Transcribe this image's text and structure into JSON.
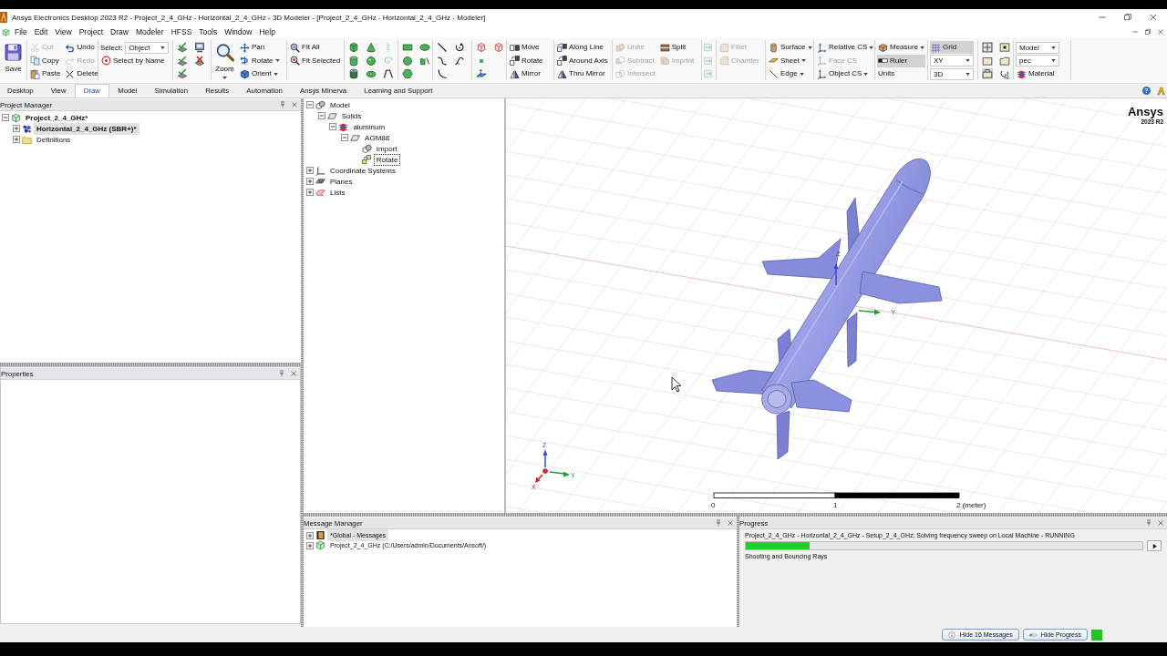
{
  "window": {
    "title": "Ansys Electronics Desktop 2023 R2 - Project_2_4_GHz - Horizontal_2_4_GHz - 3D Modeler - [Project_2_4_GHz - Horizontal_2_4_GHz - Modeler]"
  },
  "menu": [
    "File",
    "Edit",
    "View",
    "Project",
    "Draw",
    "Modeler",
    "HFSS",
    "Tools",
    "Window",
    "Help"
  ],
  "ribbon": {
    "groups": [
      {
        "columns": [
          [
            {
              "kind": "large",
              "label": "Save",
              "disabled": false,
              "on": false
            }
          ]
        ]
      },
      {
        "columns": [
          [
            {
              "kind": "button",
              "label": "Cut",
              "disabled": true,
              "on": false
            },
            {
              "kind": "button",
              "label": "Copy",
              "disabled": false,
              "on": false
            },
            {
              "kind": "button",
              "label": "Paste",
              "disabled": false,
              "on": false
            }
          ],
          [
            {
              "kind": "button",
              "label": "Undo",
              "disabled": false,
              "on": false
            },
            {
              "kind": "button",
              "label": "Redo",
              "disabled": true,
              "on": false
            },
            {
              "kind": "button",
              "label": "Delete",
              "disabled": false,
              "on": false
            }
          ]
        ]
      },
      {
        "columns": [
          [
            {
              "kind": "select",
              "label": "Select:",
              "value": "Object",
              "disabled": false,
              "on": false
            },
            {
              "kind": "button",
              "label": "Select by Name",
              "disabled": false,
              "on": false
            }
          ]
        ]
      },
      {
        "columns": [
          [
            {
              "kind": "icon",
              "disabled": false,
              "on": false
            },
            {
              "kind": "icon",
              "disabled": false,
              "on": false
            },
            {
              "kind": "icon",
              "disabled": false,
              "on": false
            }
          ],
          [
            {
              "kind": "icon",
              "disabled": false,
              "on": false
            },
            {
              "kind": "icon",
              "disabled": false,
              "on": false
            }
          ]
        ]
      },
      {
        "columns": [
          [
            {
              "kind": "large",
              "label": "Zoom",
              "menu": true,
              "disabled": false,
              "on": false
            }
          ],
          [
            {
              "kind": "button",
              "label": "Pan",
              "disabled": false,
              "on": false
            },
            {
              "kind": "button",
              "label": "Rotate",
              "menu": true,
              "disabled": false,
              "on": false
            },
            {
              "kind": "button",
              "label": "Orient",
              "menu": true,
              "disabled": false,
              "on": false
            }
          ]
        ]
      },
      {
        "columns": [
          [
            {
              "kind": "button",
              "label": "Fit All",
              "disabled": false,
              "on": false
            },
            {
              "kind": "button",
              "label": "Fit Selected",
              "disabled": false,
              "on": false
            }
          ]
        ]
      },
      {
        "columns": [
          [
            {
              "kind": "icon",
              "disabled": false,
              "on": false
            },
            {
              "kind": "icon",
              "disabled": false,
              "on": false
            },
            {
              "kind": "icon",
              "disabled": false,
              "on": false
            }
          ],
          [
            {
              "kind": "icon",
              "disabled": false,
              "on": false
            },
            {
              "kind": "icon",
              "disabled": false,
              "on": false
            },
            {
              "kind": "icon",
              "disabled": false,
              "on": false
            }
          ],
          [
            {
              "kind": "icon",
              "disabled": true,
              "on": false
            },
            {
              "kind": "icon",
              "disabled": true,
              "on": false
            },
            {
              "kind": "icon",
              "disabled": false,
              "on": false
            }
          ]
        ]
      },
      {
        "columns": [
          [
            {
              "kind": "icon",
              "disabled": false,
              "on": false
            },
            {
              "kind": "icon",
              "disabled": false,
              "on": false
            },
            {
              "kind": "icon",
              "disabled": false,
              "on": false
            }
          ],
          [
            {
              "kind": "icon",
              "disabled": false,
              "on": false
            },
            {
              "kind": "icon",
              "disabled": false,
              "on": false
            }
          ]
        ]
      },
      {
        "columns": [
          [
            {
              "kind": "icon",
              "disabled": false,
              "on": false
            },
            {
              "kind": "icon",
              "disabled": false,
              "on": false
            },
            {
              "kind": "icon",
              "disabled": false,
              "on": false
            }
          ],
          [
            {
              "kind": "icon",
              "disabled": false,
              "on": false
            },
            {
              "kind": "icon",
              "disabled": false,
              "on": false
            }
          ]
        ]
      },
      {
        "columns": [
          [
            {
              "kind": "icon",
              "disabled": false,
              "on": false
            },
            {
              "kind": "icon",
              "disabled": false,
              "on": false
            },
            {
              "kind": "icon",
              "disabled": false,
              "on": false
            }
          ],
          [
            {
              "kind": "icon",
              "disabled": false,
              "on": false
            }
          ]
        ]
      },
      {
        "columns": [
          [
            {
              "kind": "button",
              "label": "Move",
              "disabled": false,
              "on": false
            },
            {
              "kind": "button",
              "label": "Rotate",
              "disabled": false,
              "on": false
            },
            {
              "kind": "button",
              "label": "Mirror",
              "disabled": false,
              "on": false
            }
          ]
        ]
      },
      {
        "columns": [
          [
            {
              "kind": "button",
              "label": "Along Line",
              "disabled": false,
              "on": false
            },
            {
              "kind": "button",
              "label": "Around Axis",
              "disabled": false,
              "on": false
            },
            {
              "kind": "button",
              "label": "Thru Mirror",
              "disabled": false,
              "on": false
            }
          ]
        ]
      },
      {
        "columns": [
          [
            {
              "kind": "button",
              "label": "Unite",
              "disabled": true,
              "on": false
            },
            {
              "kind": "button",
              "label": "Subtract",
              "disabled": true,
              "on": false
            },
            {
              "kind": "button",
              "label": "Intersect",
              "disabled": true,
              "on": false
            }
          ],
          [
            {
              "kind": "button",
              "label": "Split",
              "disabled": false,
              "on": false
            },
            {
              "kind": "button",
              "label": "Imprint",
              "disabled": true,
              "on": false
            }
          ]
        ]
      },
      {
        "columns": [
          [
            {
              "kind": "icon",
              "disabled": true,
              "on": false
            },
            {
              "kind": "icon",
              "disabled": true,
              "on": false
            },
            {
              "kind": "icon",
              "disabled": true,
              "on": false
            }
          ]
        ]
      },
      {
        "columns": [
          [
            {
              "kind": "button",
              "label": "Fillet",
              "disabled": true,
              "on": false
            },
            {
              "kind": "button",
              "label": "Chamfer",
              "disabled": true,
              "on": false
            }
          ]
        ]
      },
      {
        "columns": [
          [
            {
              "kind": "button",
              "label": "Surface",
              "menu": true,
              "disabled": false,
              "on": false
            },
            {
              "kind": "button",
              "label": "Sheet",
              "menu": true,
              "disabled": false,
              "on": false
            },
            {
              "kind": "button",
              "label": "Edge",
              "menu": true,
              "disabled": false,
              "on": false
            }
          ]
        ]
      },
      {
        "columns": [
          [
            {
              "kind": "button",
              "label": "Relative CS",
              "menu": true,
              "disabled": false,
              "on": false
            },
            {
              "kind": "button",
              "label": "Face CS",
              "disabled": true,
              "on": false
            },
            {
              "kind": "button",
              "label": "Object CS",
              "menu": true,
              "disabled": false,
              "on": false
            }
          ]
        ]
      },
      {
        "columns": [
          [
            {
              "kind": "button",
              "label": "Measure",
              "menu": true,
              "disabled": false,
              "on": false
            },
            {
              "kind": "button",
              "label": "Ruler",
              "disabled": false,
              "on": true
            },
            {
              "kind": "text",
              "label": "Units",
              "disabled": false,
              "on": false
            }
          ]
        ]
      },
      {
        "columns": [
          [
            {
              "kind": "button",
              "label": "Grid",
              "disabled": false,
              "on": true
            },
            {
              "kind": "select",
              "value": "XY",
              "disabled": false,
              "on": false
            },
            {
              "kind": "select",
              "value": "3D",
              "disabled": false,
              "on": false
            }
          ]
        ]
      },
      {
        "columns": [
          [
            {
              "kind": "icon",
              "disabled": false,
              "on": true
            },
            {
              "kind": "icon",
              "disabled": false,
              "on": false
            },
            {
              "kind": "icon",
              "disabled": false,
              "on": true
            }
          ],
          [
            {
              "kind": "icon",
              "disabled": false,
              "on": false
            },
            {
              "kind": "icon",
              "disabled": false,
              "on": false
            },
            {
              "kind": "icon",
              "disabled": false,
              "on": false
            }
          ]
        ]
      },
      {
        "columns": [
          [
            {
              "kind": "select",
              "value": "Model",
              "disabled": false,
              "on": false
            },
            {
              "kind": "select",
              "value": "pec",
              "disabled": false,
              "on": false
            },
            {
              "kind": "button",
              "label": "Material",
              "disabled": false,
              "on": false
            }
          ]
        ]
      }
    ]
  },
  "ribbon_tabs": {
    "tabs": [
      {
        "label": "Desktop",
        "selected": false
      },
      {
        "label": "View",
        "selected": false
      },
      {
        "label": "Draw",
        "selected": true
      },
      {
        "label": "Model",
        "selected": false
      },
      {
        "label": "Simulation",
        "selected": false
      },
      {
        "label": "Results",
        "selected": false
      },
      {
        "label": "Automation",
        "selected": false
      },
      {
        "label": "Ansys Minerva",
        "selected": false
      },
      {
        "label": "Learning and Support",
        "selected": false
      }
    ],
    "help": "?"
  },
  "project_manager": {
    "title": "Project Manager",
    "items": [
      {
        "label": "Project_2_4_GHz*",
        "active": true,
        "selected": false,
        "expanded": true,
        "children": [
          {
            "label": "Horizontal_2_4_GHz (SBR+)*",
            "active": true,
            "selected": true,
            "expanded": false
          },
          {
            "label": "Definitions",
            "active": false,
            "selected": false,
            "expanded": false
          }
        ]
      }
    ]
  },
  "properties": {
    "title": "Properties"
  },
  "model_tree": {
    "items": [
      {
        "label": "Model",
        "selected": false,
        "expanded": true,
        "children": [
          {
            "label": "Solids",
            "selected": false,
            "expanded": true,
            "children": [
              {
                "label": "aluminum",
                "selected": false,
                "expanded": true,
                "children": [
                  {
                    "label": "AGM88",
                    "selected": false,
                    "expanded": true,
                    "children": [
                      {
                        "label": "Import",
                        "selected": false
                      },
                      {
                        "label": "Rotate",
                        "selected": true
                      }
                    ]
                  }
                ]
              }
            ]
          }
        ]
      },
      {
        "label": "Coordinate Systems",
        "selected": false,
        "expanded": false
      },
      {
        "label": "Planes",
        "selected": false,
        "expanded": false
      },
      {
        "label": "Lists",
        "selected": false,
        "expanded": false
      }
    ]
  },
  "viewport": {
    "logo": "Ansys",
    "version": "2023 R2",
    "axis_labels": [
      "Z",
      "Y"
    ],
    "triad_labels": [
      "Z",
      "Y",
      "X"
    ],
    "scale_labels": [
      "0",
      "1",
      "2 (meter)"
    ]
  },
  "message_manager": {
    "title": "Message Manager",
    "items": [
      {
        "label": "*Global - Messages",
        "selected": true,
        "expanded": false
      },
      {
        "label": "Project_2_4_GHz (C:/Users/admin/Documents/Ansoft/)",
        "selected": false,
        "expanded": false
      }
    ]
  },
  "progress": {
    "title": "Progress",
    "task": "Project_2_4_GHz - Horizontal_2_4_GHz - Setup_2_4_GHz: Solving frequency sweep on Local Machine - RUNNING",
    "level": 0.16,
    "step": "Shooting and Bouncing Rays"
  },
  "status_bar": {
    "buttons": [
      "Hide 16 Messages",
      "Hide Progress"
    ]
  }
}
